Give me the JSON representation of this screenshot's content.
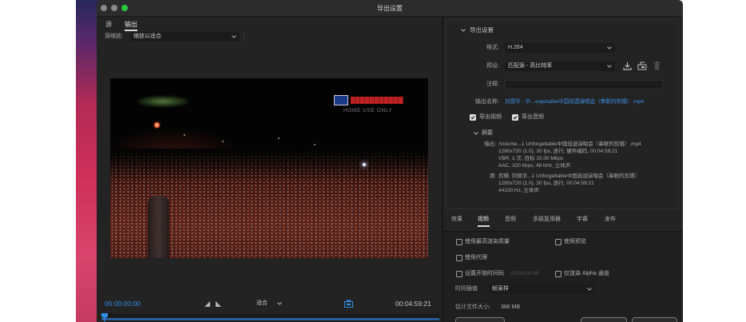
{
  "window": {
    "title": "导出设置"
  },
  "colors": {
    "accent": "#2f8ee8",
    "link": "#3d8fe6",
    "window_bg": "#232323"
  },
  "source_panel": {
    "tabs": [
      {
        "label": "源",
        "selected": false
      },
      {
        "label": "输出",
        "selected": true
      }
    ],
    "source_scaling": {
      "label": "源缩放:",
      "value": "缩放以适合"
    },
    "preview": {
      "watermark": "HOME USE ONLY"
    },
    "transport": {
      "current_timecode": "00:00:00:00",
      "zoom": "适合",
      "duration": "00:04:59:21"
    }
  },
  "export_settings": {
    "header": "导出设置",
    "format": {
      "label": "格式:",
      "value": "H.264"
    },
    "preset": {
      "label": "预设:",
      "value": "匹配源 - 高比特率"
    },
    "comment": {
      "label": "注释:",
      "value": ""
    },
    "output_name": {
      "label": "输出名称:",
      "value": "刘德华 - 中...orgettable中国巡迴演唱会（串联的剪辑）.mp4"
    },
    "export_video": {
      "label": "导出视频",
      "checked": true
    },
    "export_audio": {
      "label": "导出音频",
      "checked": true
    },
    "summary": {
      "header": "摘要",
      "output_label": "输出:",
      "output_lines": [
        "/Volume...1 Unforgettable中国巡迴演唱会（串联的剪辑）.mp4",
        "1280x720 (1.0), 30 fps, 逐行, 硬件编码, 00:04:59:21",
        "VBR, 1 次, 目标 10.00 Mbps",
        "AAC, 320 kbps, 48 kHz, 立体声"
      ],
      "source_label": "源:",
      "source_lines": [
        "剪辑, 刘德华...1 Unforgettable中国巡迴演唱会（串联的剪辑）",
        "1280x720 (1.0), 30 fps, 逐行, 00:04:59:21",
        "44100 Hz, 立体声"
      ]
    }
  },
  "settings_tabs": [
    {
      "label": "效果",
      "selected": false
    },
    {
      "label": "视频",
      "selected": true
    },
    {
      "label": "音频",
      "selected": false
    },
    {
      "label": "多路复用器",
      "selected": false
    },
    {
      "label": "字幕",
      "selected": false
    },
    {
      "label": "发布",
      "selected": false
    }
  ],
  "video_settings": {
    "max_render_quality": {
      "label": "使用最高渲染质量",
      "checked": false
    },
    "use_previews": {
      "label": "使用预览",
      "checked": false
    },
    "use_proxies": {
      "label": "使用代理",
      "checked": false
    },
    "set_start_timecode": {
      "label": "设置开始时间码",
      "checked": false,
      "value": "00:00:00:00"
    },
    "render_alpha_only": {
      "label": "仅渲染 Alpha 通道",
      "checked": false
    },
    "time_interpolation": {
      "label": "时间插值",
      "value": "帧采样"
    },
    "estimated_file_size": {
      "label": "估计文件大小:",
      "value": "386 MB"
    }
  }
}
